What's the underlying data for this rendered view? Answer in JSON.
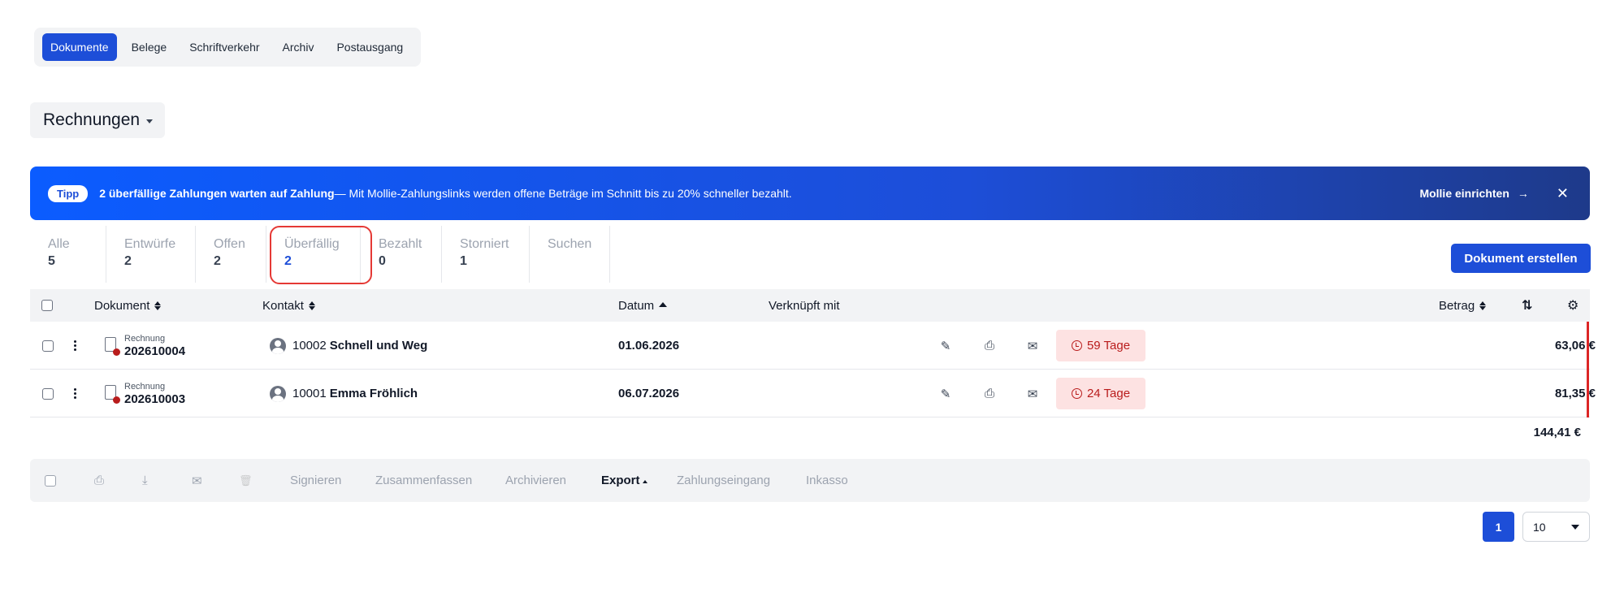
{
  "topnav": {
    "tabs": [
      {
        "label": "Dokumente",
        "active": true
      },
      {
        "label": "Belege"
      },
      {
        "label": "Schriftverkehr"
      },
      {
        "label": "Archiv"
      },
      {
        "label": "Postausgang"
      }
    ]
  },
  "doctype": {
    "label": "Rechnungen"
  },
  "banner": {
    "pill": "Tipp",
    "headline": "2 überfällige Zahlungen warten auf Zahlung",
    "text": " — Mit Mollie-Zahlungslinks werden offene Beträge im Schnitt bis zu 20% schneller bezahlt.",
    "cta": "Mollie einrichten",
    "cta_arrow": "→",
    "close": "✕"
  },
  "status_tabs": [
    {
      "label": "Alle",
      "count": "5"
    },
    {
      "label": "Entwürfe",
      "count": "2"
    },
    {
      "label": "Offen",
      "count": "2"
    },
    {
      "label": "Überfällig",
      "count": "2",
      "active": true
    },
    {
      "label": "Bezahlt",
      "count": "0"
    },
    {
      "label": "Storniert",
      "count": "1"
    },
    {
      "label": "Suchen",
      "count": ""
    }
  ],
  "create_button": "Dokument erstellen",
  "table": {
    "headers": {
      "dokument": "Dokument",
      "kontakt": "Kontakt",
      "datum": "Datum",
      "verknuepft": "Verknüpft mit",
      "betrag": "Betrag",
      "sort_toggle": "⇅",
      "settings": "⚙"
    },
    "rows": [
      {
        "doc_type": "Rechnung",
        "doc_number": "202610004",
        "contact_id": "10002",
        "contact_name": "Schnell und Weg",
        "date": "01.06.2026",
        "overdue": "59 Tage",
        "amount": "63,06 €"
      },
      {
        "doc_type": "Rechnung",
        "doc_number": "202610003",
        "contact_id": "10001",
        "contact_name": "Emma Fröhlich",
        "date": "06.07.2026",
        "overdue": "24 Tage",
        "amount": "81,35 €"
      }
    ],
    "total": "144,41 €",
    "row_icons": {
      "edit": "✎",
      "print": "⎙",
      "mail": "✉"
    }
  },
  "bulkbar": {
    "icons": {
      "print": "⎙",
      "download": "⤓",
      "mail": "✉",
      "trash": "🗑"
    },
    "actions": {
      "sign": "Signieren",
      "merge": "Zusammenfassen",
      "archive": "Archivieren",
      "export": "Export",
      "payment": "Zahlungseingang",
      "collection": "Inkasso"
    }
  },
  "pagination": {
    "page": "1",
    "page_size": "10"
  }
}
